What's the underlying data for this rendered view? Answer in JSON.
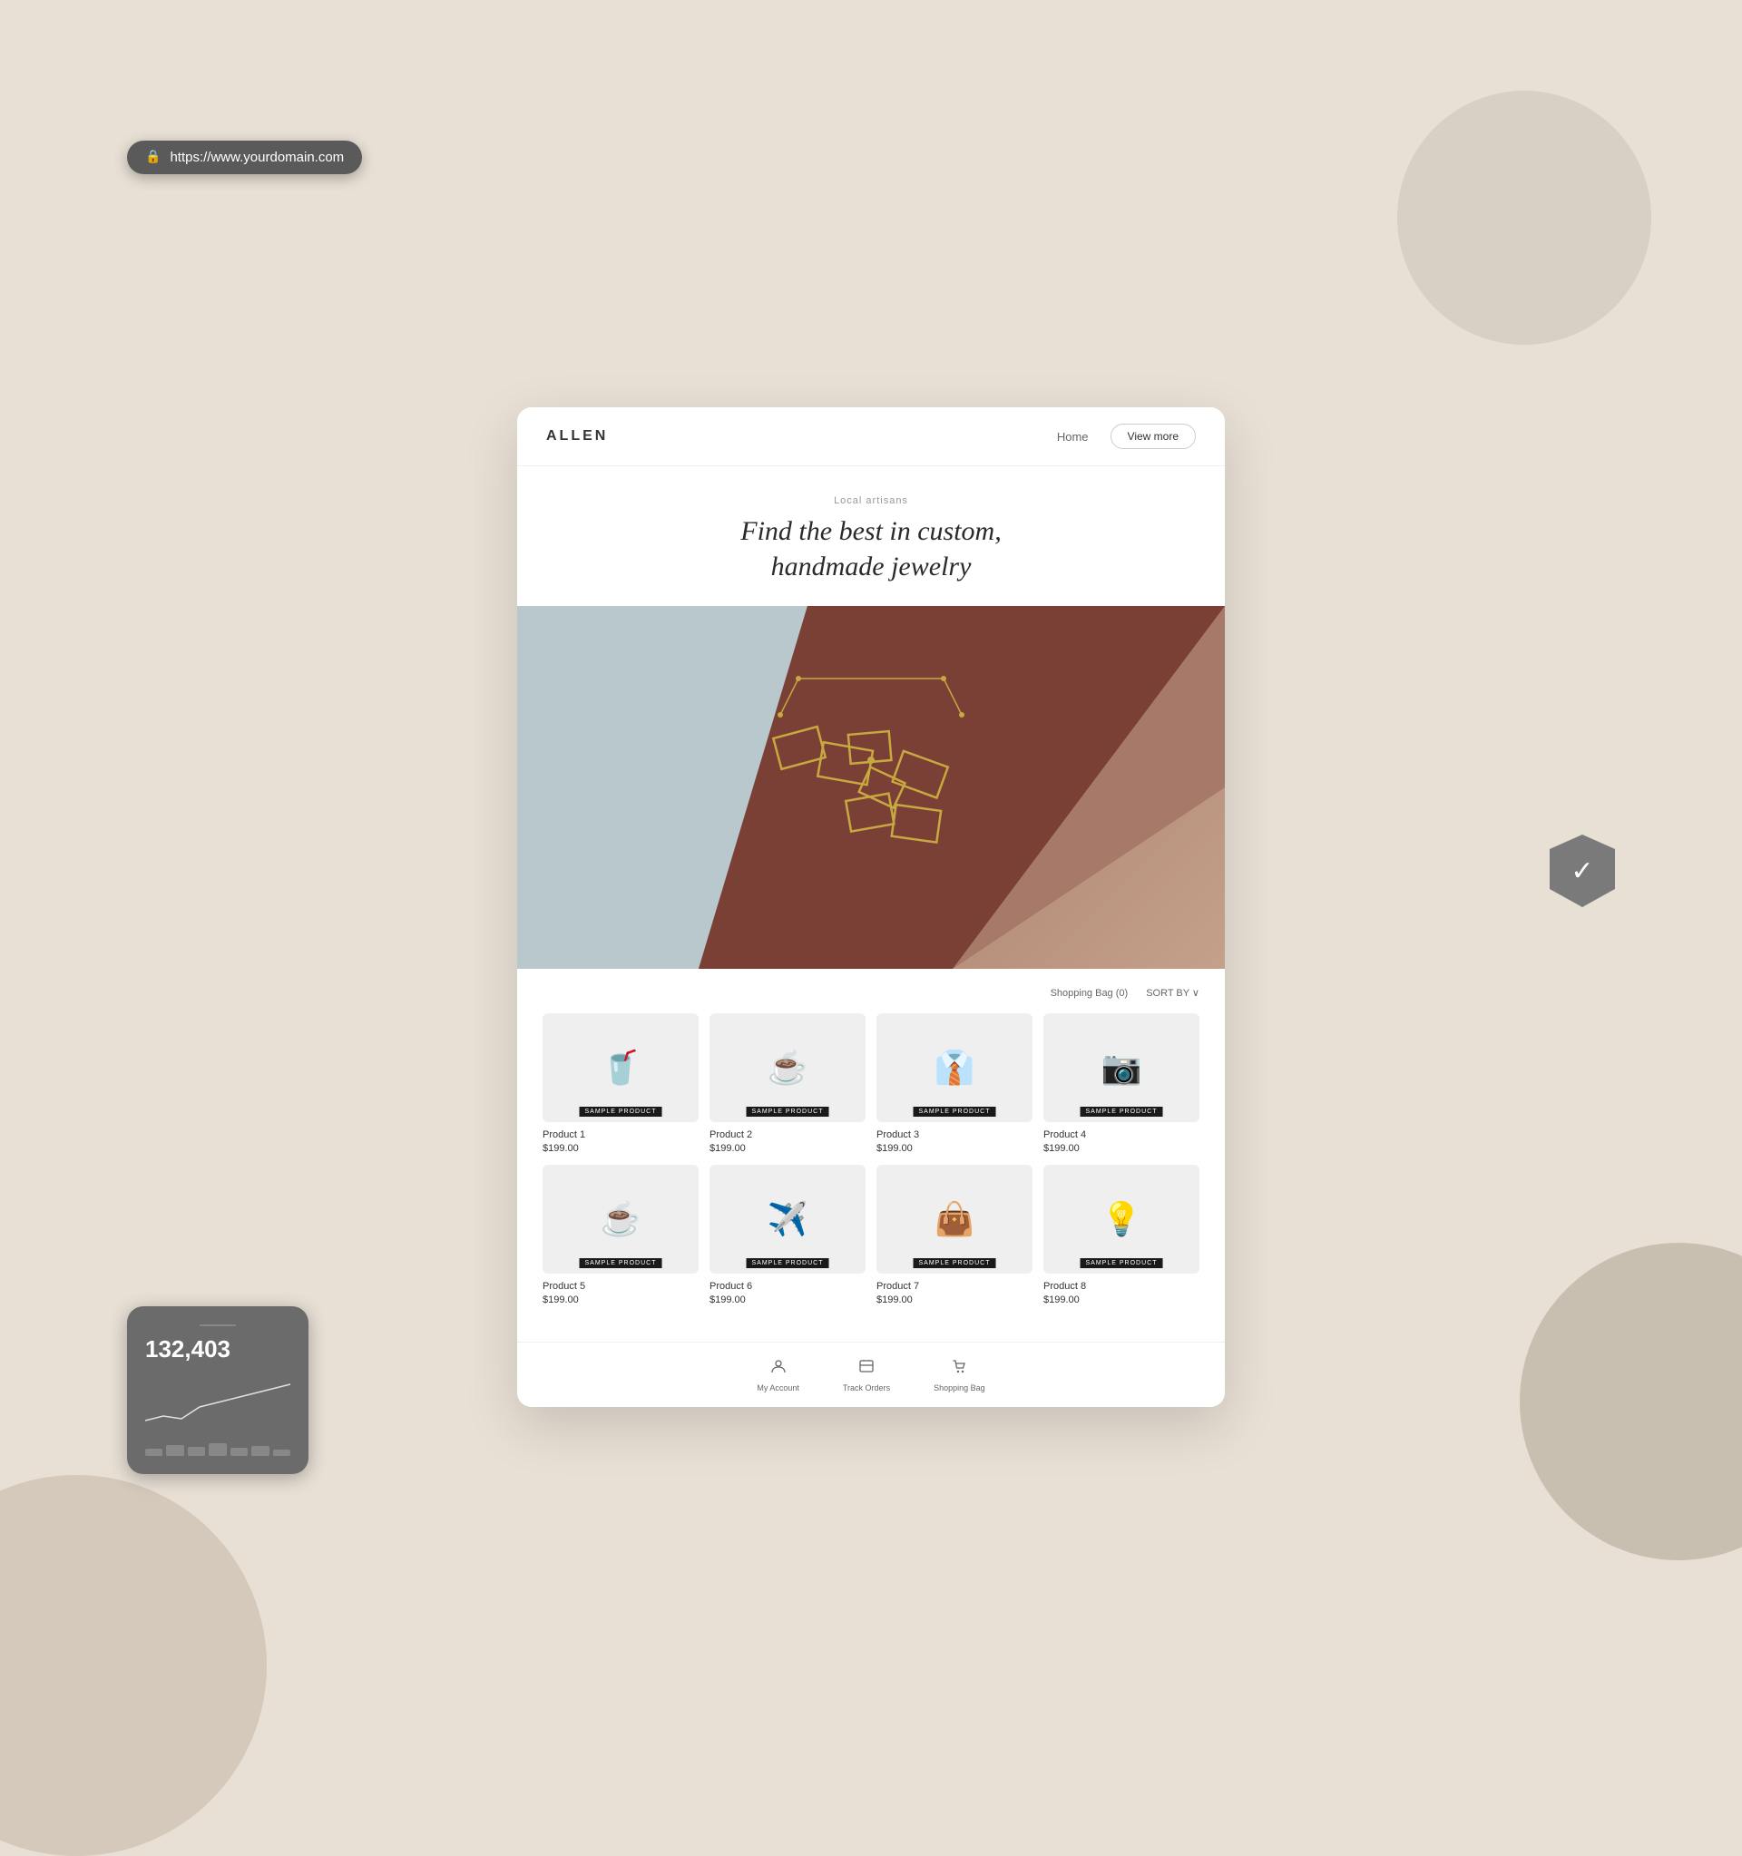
{
  "browser": {
    "url": "https://www.yourdomain.com"
  },
  "site": {
    "logo": "ALLEN",
    "nav": {
      "home": "Home",
      "view_more": "View more"
    },
    "hero": {
      "subtitle": "Local artisans",
      "title_line1": "Find the best in custom,",
      "title_line2": "handmade jewelry"
    },
    "products_header": {
      "shopping_bag": "Shopping Bag (0)",
      "sort_by": "SORT BY ∨"
    },
    "products": [
      {
        "name": "Product 1",
        "price": "$199.00",
        "badge": "SAMPLE PRODUCT",
        "icon": "🥤"
      },
      {
        "name": "Product 2",
        "price": "$199.00",
        "badge": "SAMPLE PRODUCT",
        "icon": "☕"
      },
      {
        "name": "Product 3",
        "price": "$199.00",
        "badge": "SAMPLE PRODUCT",
        "icon": "👔"
      },
      {
        "name": "Product 4",
        "price": "$199.00",
        "badge": "SAMPLE PRODUCT",
        "icon": "📷"
      },
      {
        "name": "Product 5",
        "price": "$199.00",
        "badge": "SAMPLE PRODUCT",
        "icon": "☕"
      },
      {
        "name": "Product 6",
        "price": "$199.00",
        "badge": "SAMPLE PRODUCT",
        "icon": "✈️"
      },
      {
        "name": "Product 7",
        "price": "$199.00",
        "badge": "SAMPLE PRODUCT",
        "icon": "👜"
      },
      {
        "name": "Product 8",
        "price": "$199.00",
        "badge": "SAMPLE PRODUCT",
        "icon": "💡"
      }
    ],
    "bottom_nav": [
      {
        "label": "My Account",
        "icon": "○"
      },
      {
        "label": "Track Orders",
        "icon": "○"
      },
      {
        "label": "Shopping Bag",
        "icon": "○"
      }
    ]
  },
  "stats_widget": {
    "number": "132,403"
  },
  "colors": {
    "accent": "#c4a882",
    "dark": "#333333",
    "background": "#e8e0d5"
  }
}
